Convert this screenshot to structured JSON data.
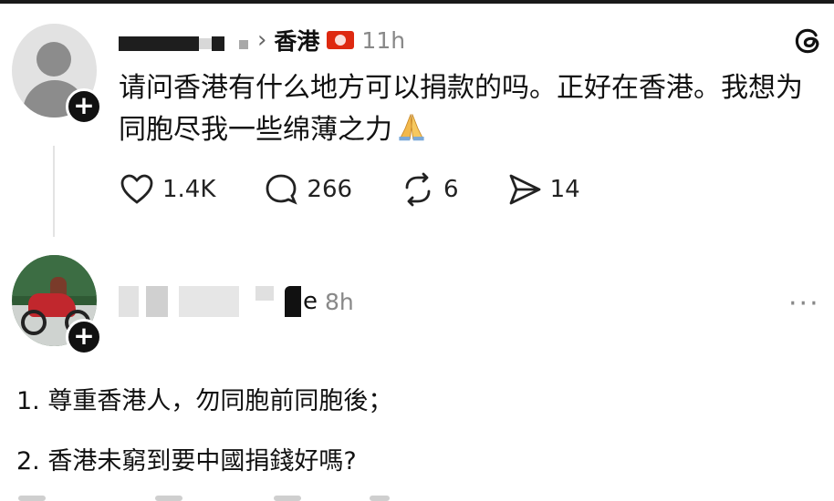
{
  "post1": {
    "username_hidden": "",
    "location": "香港",
    "time": "11h",
    "text": "请问香港有什么地方可以捐款的吗。正好在香港。我想为同胞尽我一些绵薄之力",
    "likes": "1.4K",
    "comments": "266",
    "reposts": "6",
    "shares": "14"
  },
  "post2": {
    "username_tail": "e",
    "time": "8h",
    "more": "···",
    "line1": "1. 尊重香港人，勿同胞前同胞後；",
    "line2": "2. 香港未窮到要中國捐錢好嗎?"
  },
  "icons": {
    "like": "heart-icon",
    "comment": "comment-bubble-icon",
    "repost": "repost-icon",
    "share": "send-icon",
    "app": "threads-logo-icon",
    "flag": "hong-kong-flag-icon",
    "prayer": "folded-hands-emoji"
  }
}
